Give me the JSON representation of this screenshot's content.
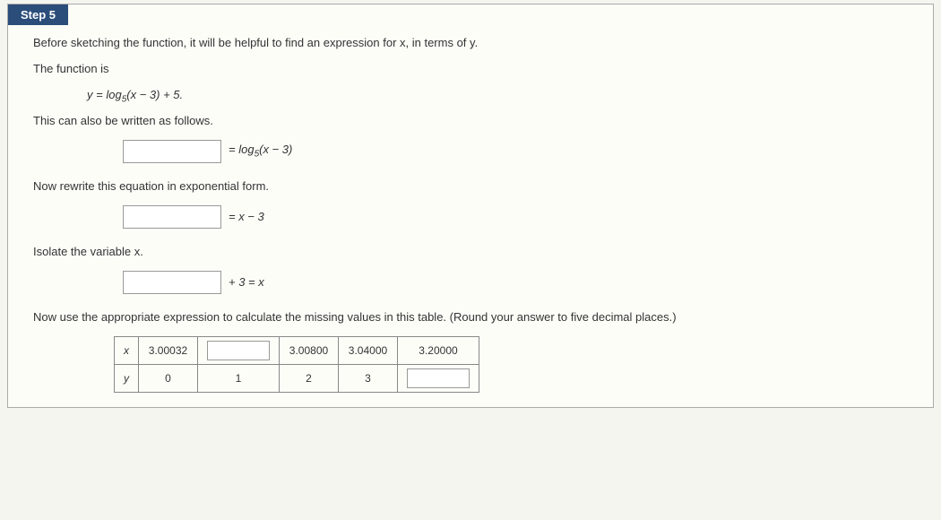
{
  "step": {
    "label": "Step 5"
  },
  "intro": "Before sketching the function, it will be helpful to find an expression for x, in terms of y.",
  "func_lead": "The function is",
  "func_formula_html": "y = log₅(x − 3) + 5.",
  "rewrite_lead": "This can also be written as follows.",
  "eq1_rhs": " = log₅(x − 3)",
  "exp_lead": "Now rewrite this equation in exponential form.",
  "eq2_rhs": " = x − 3",
  "isolate_lead": "Isolate the variable x.",
  "eq3_rhs": " + 3 = x",
  "table_lead": "Now use the appropriate expression to calculate the missing values in this table. (Round your answer to five decimal places.)",
  "table": {
    "x_label": "x",
    "y_label": "y",
    "x_row": [
      "3.00032",
      "",
      "3.00800",
      "3.04000",
      "3.20000"
    ],
    "y_row": [
      "0",
      "1",
      "2",
      "3",
      ""
    ]
  }
}
